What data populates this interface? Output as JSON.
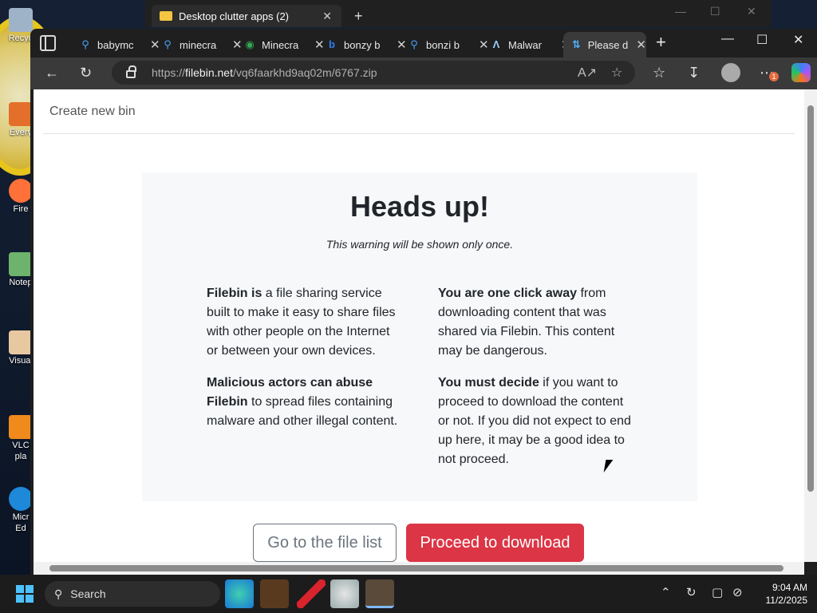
{
  "desktop": {
    "icons": [
      "Recyc",
      "Every",
      "Fire",
      "Notep",
      "Visual",
      "VLC",
      "pla",
      "Micr",
      "Ed"
    ]
  },
  "back_window": {
    "tab_title": "Desktop clutter apps (2)",
    "close": "✕",
    "plus": "+",
    "controls": [
      "—",
      "☐",
      "✕"
    ]
  },
  "browser": {
    "tabs": [
      {
        "title": "babymc",
        "icon": "search"
      },
      {
        "title": "minecra",
        "icon": "search"
      },
      {
        "title": "Minecra",
        "icon": "chrome"
      },
      {
        "title": "bonzy b",
        "icon": "bing"
      },
      {
        "title": "bonzi b",
        "icon": "search"
      },
      {
        "title": "Malwar",
        "icon": "a"
      },
      {
        "title": "Please d",
        "icon": "filebin"
      }
    ],
    "tab_close": "✕",
    "new_tab": "+",
    "window_controls": [
      "—",
      "☐",
      "✕"
    ],
    "url_prefix": "https://",
    "url_domain": "filebin.net",
    "url_path": "/vq6faarkhd9aq02m/6767.zip",
    "download_badge": "1"
  },
  "page": {
    "nav_link": "Create new bin",
    "heading": "Heads up!",
    "subtitle": "This warning will be shown only once.",
    "p1_bold": "Filebin is",
    "p1_text": " a file sharing service built to make it easy to share files with other people on the Internet or between your own devices.",
    "p2_bold": "Malicious actors can abuse Filebin",
    "p2_text": " to spread files containing malware and other illegal content.",
    "p3_bold": "You are one click away",
    "p3_text": " from downloading content that was shared via Filebin. This content may be dangerous.",
    "p4_bold": "You must decide",
    "p4_text": " if you want to proceed to download the content or not. If you did not expect to end up here, it may be a good idea to not proceed.",
    "btn_file_list": "Go to the file list",
    "btn_download": "Proceed to download",
    "colors": {
      "danger": "#dc3545",
      "outline": "#6c757d",
      "card_bg": "#f7f8fa"
    }
  },
  "taskbar": {
    "search_label": "Search",
    "time": "9:04 AM",
    "date": "11/2/2025"
  }
}
